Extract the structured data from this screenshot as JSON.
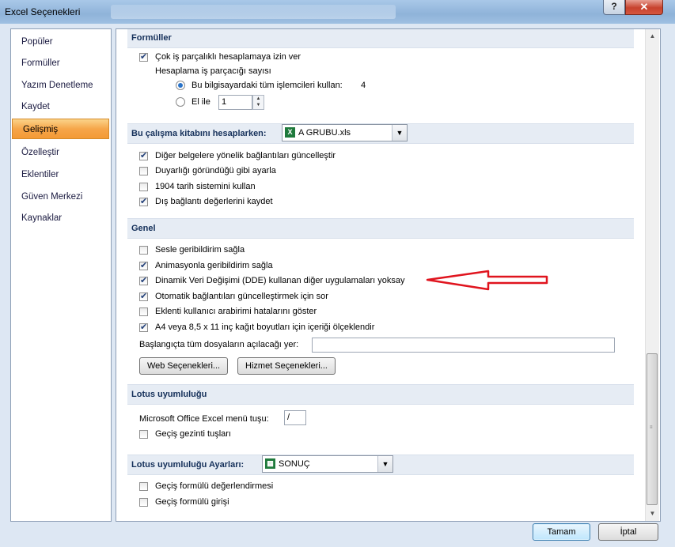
{
  "window": {
    "title": "Excel Seçenekleri",
    "help_label": "?",
    "close_label": "✕"
  },
  "sidebar": {
    "items": [
      {
        "label": "Popüler"
      },
      {
        "label": "Formüller"
      },
      {
        "label": "Yazım Denetleme"
      },
      {
        "label": "Kaydet"
      },
      {
        "label": "Gelişmiş",
        "selected": true
      },
      {
        "label": "Özelleştir"
      },
      {
        "label": "Eklentiler"
      },
      {
        "label": "Güven Merkezi"
      },
      {
        "label": "Kaynaklar"
      }
    ]
  },
  "formulas": {
    "header": "Formüller",
    "multithread_label": "Çok iş parçalıklı hesaplamaya izin ver",
    "multithread_checked": true,
    "thread_count_label": "Hesaplama iş parçacığı sayısı",
    "all_processors_label": "Bu bilgisayardaki tüm işlemcileri kullan:",
    "processor_count": "4",
    "manual_label": "El ile",
    "manual_value": "1"
  },
  "workbook": {
    "header": "Bu çalışma kitabını hesaplarken:",
    "selected_workbook": "A GRUBU.xls",
    "options": [
      {
        "label": "Diğer belgelere yönelik bağlantıları güncelleştir",
        "checked": true
      },
      {
        "label": "Duyarlığı göründüğü gibi ayarla",
        "checked": false
      },
      {
        "label": "1904 tarih sistemini kullan",
        "checked": false
      },
      {
        "label": "Dış bağlantı değerlerini kaydet",
        "checked": true
      }
    ]
  },
  "general": {
    "header": "Genel",
    "options": [
      {
        "label": "Sesle geribildirim sağla",
        "checked": false
      },
      {
        "label": "Animasyonla geribildirim sağla",
        "checked": true
      },
      {
        "label": "Dinamik Veri Değişimi (DDE) kullanan diğer uygulamaları yoksay",
        "checked": true
      },
      {
        "label": "Otomatik bağlantıları güncelleştirmek için sor",
        "checked": true
      },
      {
        "label": "Eklenti kullanıcı arabirimi hatalarını göster",
        "checked": false
      },
      {
        "label": "A4 veya 8,5 x 11 inç kağıt boyutları için içeriği ölçeklendir",
        "checked": true
      }
    ],
    "startup_label": "Başlangıçta tüm dosyaların açılacağı yer:",
    "startup_value": "",
    "web_options_button": "Web Seçenekleri...",
    "service_options_button": "Hizmet Seçenekleri..."
  },
  "lotus": {
    "header": "Lotus uyumluluğu",
    "menu_key_label": "Microsoft Office Excel menü tuşu:",
    "menu_key_value": "/",
    "transition_nav_label": "Geçiş gezinti tuşları",
    "transition_nav_checked": false
  },
  "lotus_settings": {
    "header": "Lotus uyumluluğu Ayarları:",
    "selected_sheet": "SONUÇ",
    "options": [
      {
        "label": "Geçiş formülü değerlendirmesi",
        "checked": false
      },
      {
        "label": "Geçiş formülü girişi",
        "checked": false
      }
    ]
  },
  "footer": {
    "ok_label": "Tamam",
    "cancel_label": "İptal"
  },
  "annotation": {
    "arrow_color": "#e0141e"
  }
}
